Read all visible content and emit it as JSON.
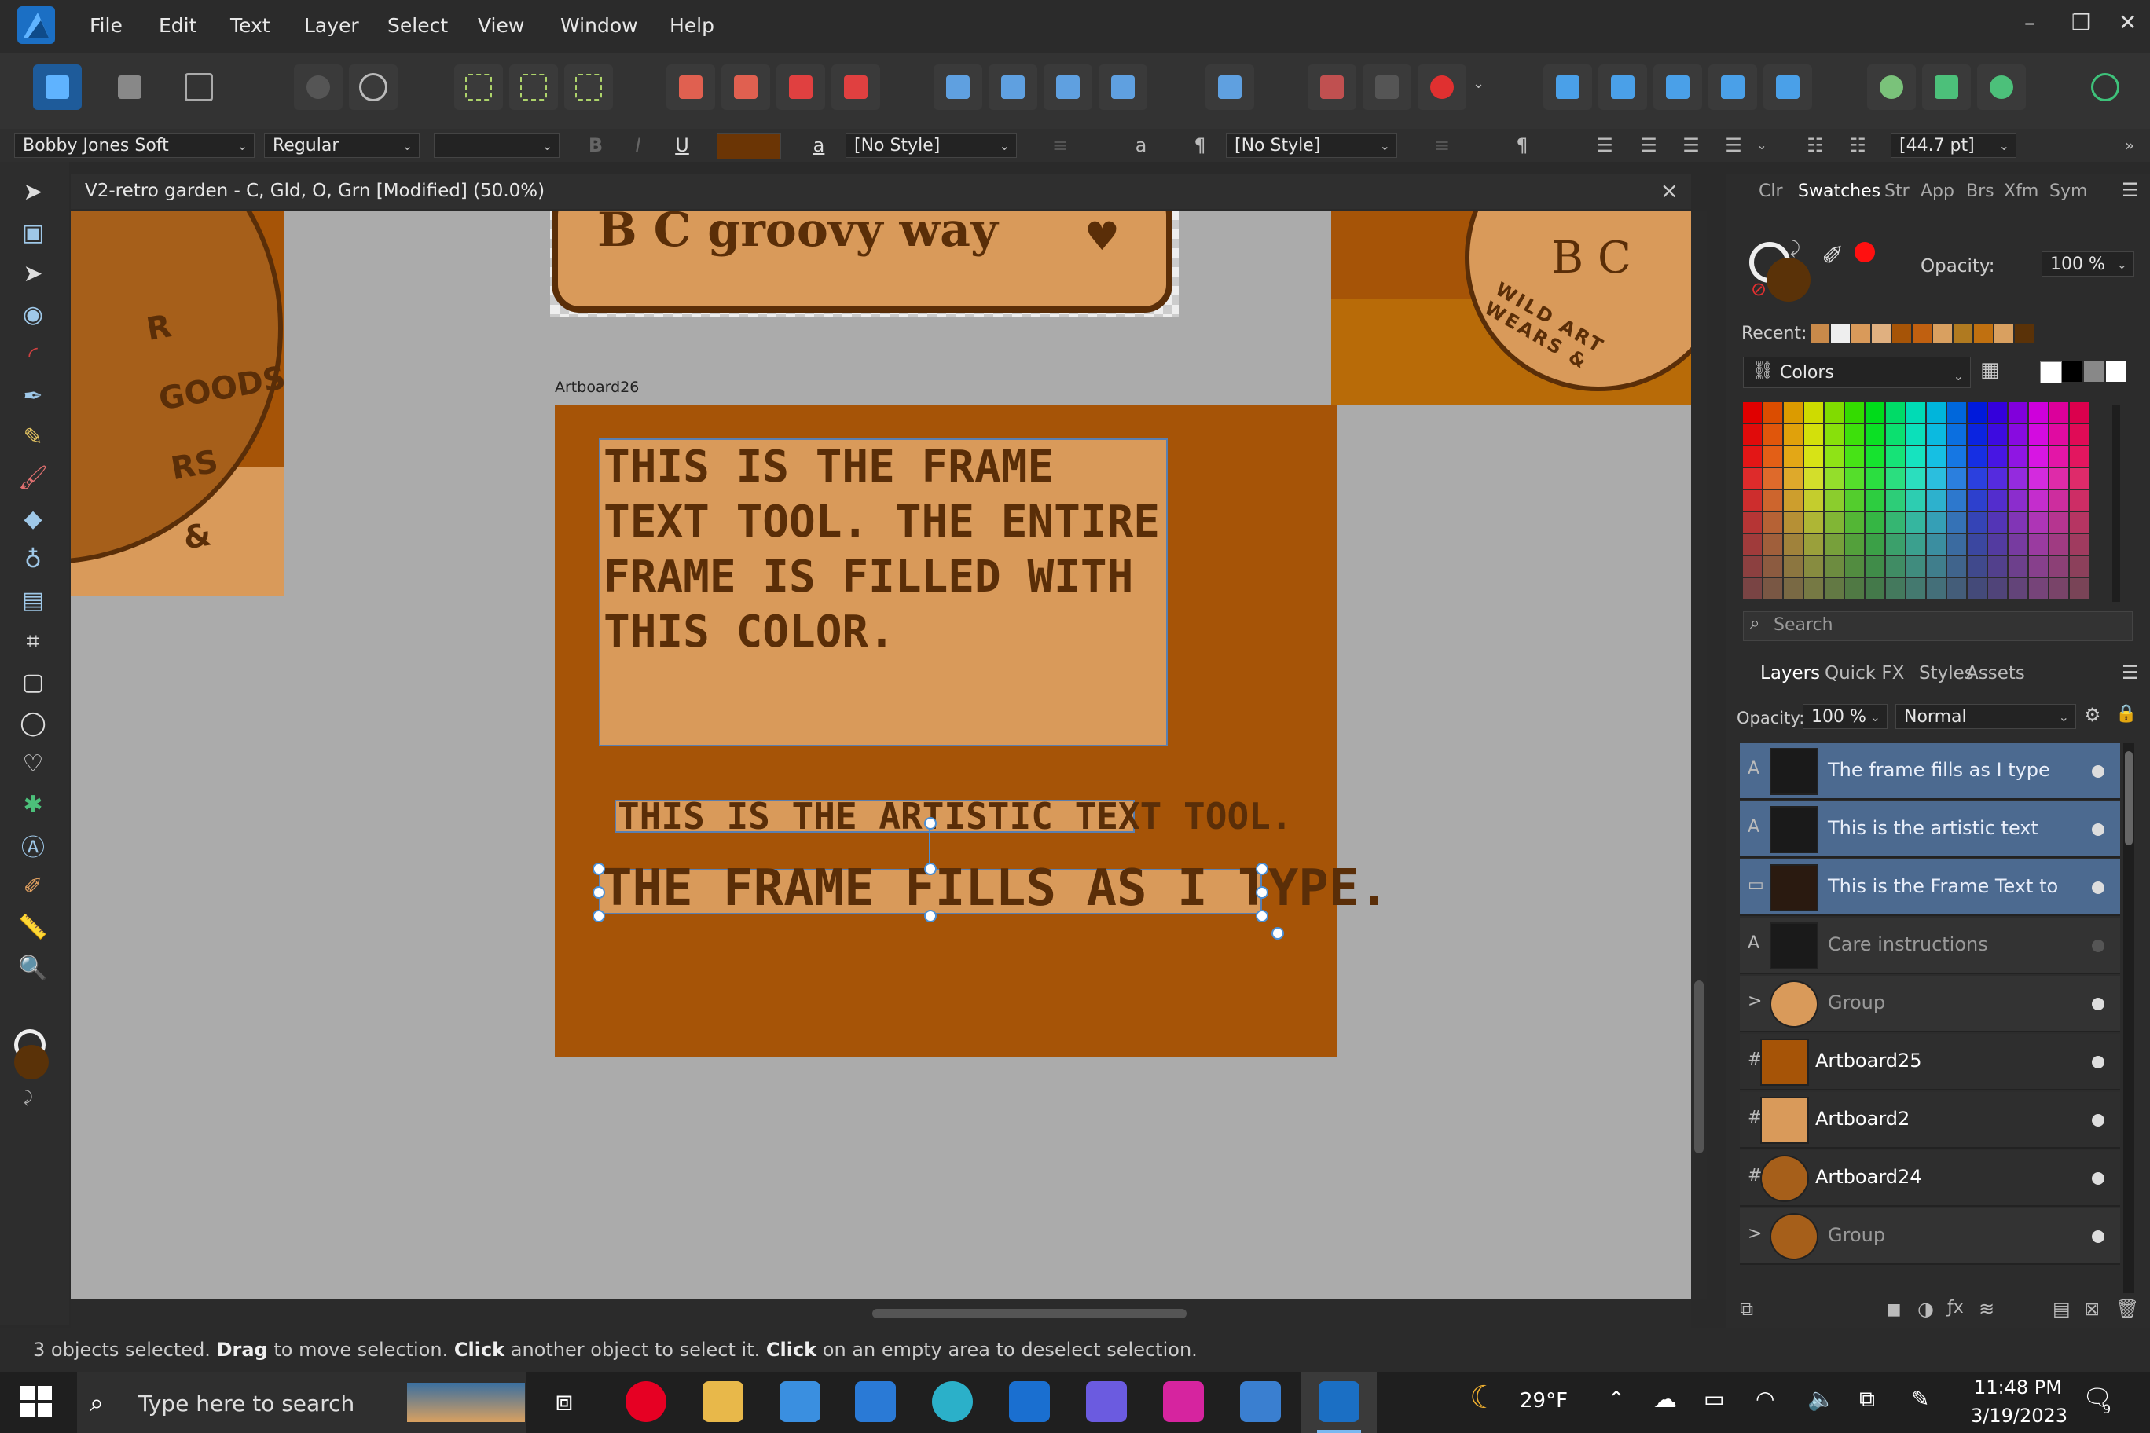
{
  "menu": [
    "File",
    "Edit",
    "Text",
    "Layer",
    "Select",
    "View",
    "Window",
    "Help"
  ],
  "context": {
    "font_family": "Bobby Jones Soft",
    "font_style": "Regular",
    "font_size": "",
    "bold": "B",
    "italic": "I",
    "underline": "U",
    "text_style_glyph": "a",
    "char_style": "[No Style]",
    "para_glyph": "a",
    "pilcrow": "¶",
    "para_style": "[No Style]",
    "pilcrow2": "¶",
    "leading": "[44.7 pt]",
    "fill_color": "#6b3505"
  },
  "document": {
    "title": "V2-retro garden - C, Gld, O, Grn [Modified] (50.0%)",
    "close": "×"
  },
  "canvas": {
    "artboard_label": "Artboard26",
    "frame_text": "THIS IS THE FRAME TEXT TOOL. THE ENTIRE FRAME IS FILLED WITH THIS COLOR.",
    "artistic_text": "THIS IS THE ARTISTIC TEXT TOOL.",
    "fill_text": "THE FRAME FILLS AS I TYPE.",
    "top_card_text": "B C groovy way",
    "badge_text": "WILD ART WEARS &",
    "badge_initials": "B C",
    "coin_text": "R  GOODS  RS &"
  },
  "swatches_panel": {
    "tabs": [
      "Clr",
      "Swatches",
      "Str",
      "App",
      "Brs",
      "Xfm",
      "Sym"
    ],
    "active_tab": "Swatches",
    "opacity_label": "Opacity:",
    "opacity_value": "100 %",
    "recent_label": "Recent:",
    "palette_name": "Colors",
    "search_placeholder": "Search",
    "primary_color": "#5a3208",
    "secondary_color": "#ffffff"
  },
  "layers_panel": {
    "tabs": [
      "Layers",
      "Quick FX",
      "Styles",
      "Assets"
    ],
    "active_tab": "Layers",
    "opacity_label": "Opacity:",
    "opacity_value": "100 %",
    "blend_mode": "Normal",
    "rows": [
      {
        "type": "A",
        "name": "The frame fills as I type",
        "state": "selected"
      },
      {
        "type": "A",
        "name": "This is the artistic text",
        "state": "selected"
      },
      {
        "type": "▭",
        "name": "This is the Frame Text to",
        "state": "selected"
      },
      {
        "type": "A",
        "name": "Care instructions",
        "state": "dim"
      },
      {
        "type": ">",
        "name": "Group",
        "state": "dim"
      },
      {
        "type": "#",
        "name": "Artboard25",
        "state": "artboard"
      },
      {
        "type": "#",
        "name": "Artboard2",
        "state": "artboard"
      },
      {
        "type": "#",
        "name": "Artboard24",
        "state": "artboard"
      },
      {
        "type": ">",
        "name": "Group",
        "state": "dim"
      }
    ]
  },
  "status": {
    "count": "3 objects selected.",
    "drag": "Drag",
    "drag_rest": "to move selection.",
    "click1": "Click",
    "click1_rest": "another object to select it.",
    "click2": "Click",
    "click2_rest": "on an empty area to deselect selection."
  },
  "taskbar": {
    "search_placeholder": "Type here to search",
    "temperature": "29°F",
    "time": "11:48 PM",
    "date": "3/19/2023",
    "notification_count": "9"
  },
  "colors": {
    "accent": "#4a8fd6",
    "artboard_bg": "#a65407",
    "frame_fill": "#d99a5a",
    "text_brown": "#5a2e08"
  }
}
